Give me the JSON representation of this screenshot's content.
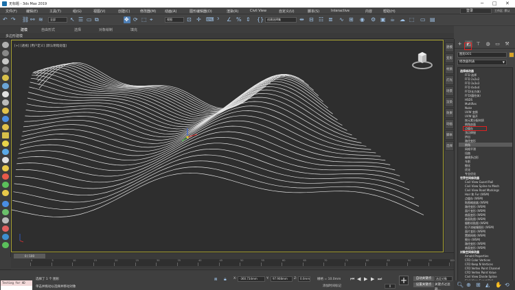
{
  "window": {
    "title": "无标题 - 3ds Max 2019",
    "minimize": "─",
    "maximize": "□",
    "close": "✕"
  },
  "menu": {
    "items": [
      "文件(F)",
      "编辑(E)",
      "工具(T)",
      "组(G)",
      "视图(V)",
      "创建(C)",
      "修改器(M)",
      "动画(A)",
      "图形编辑器(D)",
      "渲染(R)",
      "Civil View",
      "自定义(U)",
      "脚本(S)",
      "Interactive",
      "内容",
      "帮助(H)"
    ],
    "login": "登录",
    "workspace": "工作区: 默认"
  },
  "toolbar": {
    "filter": "全部",
    "refcoord": "视图",
    "selset": "创建选择集"
  },
  "ribbon": {
    "tabs": [
      "建模",
      "自由形式",
      "选择",
      "对象绘制",
      "填充"
    ],
    "subtab": "多边形建模"
  },
  "viewport": {
    "label": "[+] [透视] [用户定义] [默认明暗处理]",
    "border_color": "#a8a232",
    "background": "#2e2e2e"
  },
  "side_tabs": [
    "建模",
    "变形",
    "材质",
    "灯光",
    "场景",
    "渲染",
    "效果",
    "动画",
    "脚本",
    "选择"
  ],
  "command_panel": {
    "tabs": [
      "+",
      "modify",
      "hierarchy",
      "motion",
      "display",
      "utilities"
    ],
    "object_name": "图形001",
    "object_color": "#d8a428",
    "modifier_list": "修改器列表",
    "items": [
      {
        "label": "选择修改器",
        "head": true
      },
      {
        "label": "FFD 选择"
      },
      {
        "label": "FFD 2x2x2"
      },
      {
        "label": "FFD 3x3x3"
      },
      {
        "label": "FFD 4x4x4"
      },
      {
        "label": "FFD(长方体)"
      },
      {
        "label": "FFD(圆柱体)"
      },
      {
        "label": "HSDS"
      },
      {
        "label": "MultiRes"
      },
      {
        "label": "Nuke"
      },
      {
        "label": "UVW 变换"
      },
      {
        "label": "UVW 展开"
      },
      {
        "label": "按元素分配材质"
      },
      {
        "label": "倒角剖面"
      },
      {
        "label": "点缓存"
      },
      {
        "label": "顶点焊接"
      },
      {
        "label": "挤出"
      },
      {
        "label": "路径变形"
      },
      {
        "label": "倒角"
      },
      {
        "label": "网格平滑"
      },
      {
        "label": "扭曲"
      },
      {
        "label": "编辑多边形"
      },
      {
        "label": "车削"
      },
      {
        "label": "细化"
      },
      {
        "label": "优化"
      },
      {
        "label": "专业优化"
      },
      {
        "label": "世界空间修改器",
        "head": true
      },
      {
        "label": "Civil View Guard Rail"
      },
      {
        "label": "Civil View Spline to Mesh"
      },
      {
        "label": "Civil View Road Markings"
      },
      {
        "label": "Hair 和 Fur (WSM)"
      },
      {
        "label": "点缓存 (WSM)"
      },
      {
        "label": "贴图缩放器 (WSM)"
      },
      {
        "label": "路径变形 (WSM)"
      },
      {
        "label": "面片变形 (WSM)"
      },
      {
        "label": "曲面变形 (WSM)"
      },
      {
        "label": "曲面贴图 (WSM)"
      },
      {
        "label": "摄影机贴图 (WSM)"
      },
      {
        "label": "粒子流碰撞图形 (WSM)"
      },
      {
        "label": "面片变形 (WSM)"
      },
      {
        "label": "置换网格 (WSM)"
      },
      {
        "label": "细分 (WSM)"
      },
      {
        "label": "路径变形 (WSM)"
      },
      {
        "label": "曲面变形 (WSM)"
      },
      {
        "label": "对象空间修改器",
        "head": true
      },
      {
        "label": "Arnold Properties"
      },
      {
        "label": "CFD Color Vertices"
      },
      {
        "label": "CFD Keep N Vertices"
      },
      {
        "label": "CFD Vertex Paint Channel"
      },
      {
        "label": "CFD Vertex Paint Value"
      },
      {
        "label": "Civil View Divide Spline"
      },
      {
        "label": "Civil View Guard Rail"
      },
      {
        "label": "Civil View Road Markings"
      },
      {
        "label": "Civil View Spline to Mesh"
      }
    ],
    "selected_index": 18
  },
  "timeline": {
    "slider": "0 / 100",
    "ticks": [
      0,
      5,
      10,
      15,
      20,
      25,
      30,
      35,
      40,
      45,
      50,
      55,
      60,
      65,
      70,
      75,
      80,
      85,
      90,
      95,
      100
    ]
  },
  "status": {
    "maxscript": "Testing for AD",
    "selected": "选择了 1 个 图形",
    "hint": "单击并拖动以选择并移动对象",
    "x_label": "X:",
    "x": "-360.734mm",
    "y_label": "Y:",
    "y": "97.908mm",
    "z_label": "Z:",
    "z": "0.0mm",
    "grid": "栅格 = 10.0mm",
    "add_time_tag": "添加时间标记",
    "frame": "0",
    "auto_key": "自动关键点",
    "set_key": "设置关键点",
    "sel_set": "选定对象",
    "key_filter": "关键点过滤器..."
  }
}
